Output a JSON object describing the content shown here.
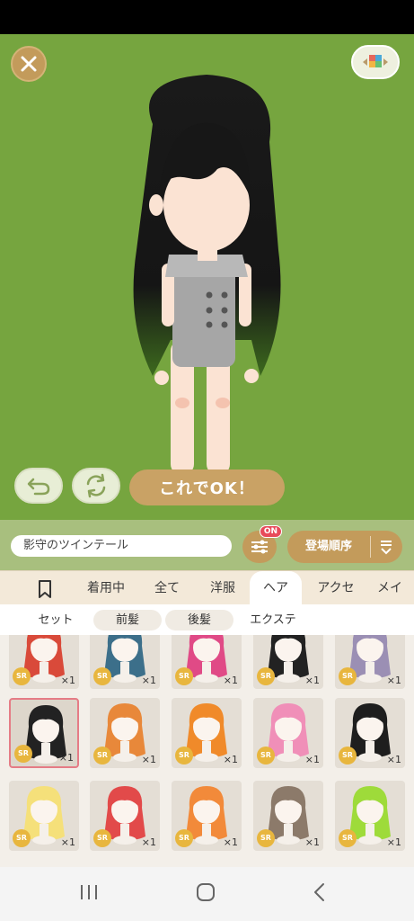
{
  "stage": {
    "close_icon": "close-icon",
    "view_icon": "palette-view-icon",
    "ok_label": "これでOK！",
    "undo_icon": "undo-icon",
    "shuffle_icon": "shuffle-icon",
    "background_color": "#76a53f"
  },
  "filter": {
    "item_name": "影守のツインテール",
    "filter_badge": "ON",
    "sort_label": "登場順序",
    "sort_icon": "sort-icon"
  },
  "tabs": {
    "bookmark_icon": "bookmark-icon",
    "items": [
      "着用中",
      "全て",
      "洋服",
      "ヘア",
      "アクセ",
      "メイク"
    ],
    "active": "ヘア"
  },
  "subtabs": {
    "items": [
      "セット",
      "前髪",
      "後髪",
      "エクステ"
    ],
    "active": [
      "前髪",
      "後髪"
    ]
  },
  "grid": {
    "rarity": "SR",
    "quantity": "×1",
    "items": [
      {
        "hair": "#d94a3a"
      },
      {
        "hair": "#3c6f8a"
      },
      {
        "hair": "#e04a86"
      },
      {
        "hair": "#222222"
      },
      {
        "hair": "#9b8fb4"
      },
      {
        "hair": "#222222",
        "selected": true
      },
      {
        "hair": "#e8883a"
      },
      {
        "hair": "#f08a2a"
      },
      {
        "hair": "#f08fb8"
      },
      {
        "hair": "#1e1e1e"
      },
      {
        "hair": "#f5e07a"
      },
      {
        "hair": "#e24a4a"
      },
      {
        "hair": "#f28a3a"
      },
      {
        "hair": "#8c7a6a"
      },
      {
        "hair": "#9edb3a"
      }
    ]
  },
  "nav": {
    "recents_icon": "recents-icon",
    "home_icon": "home-icon",
    "back_icon": "back-icon"
  }
}
